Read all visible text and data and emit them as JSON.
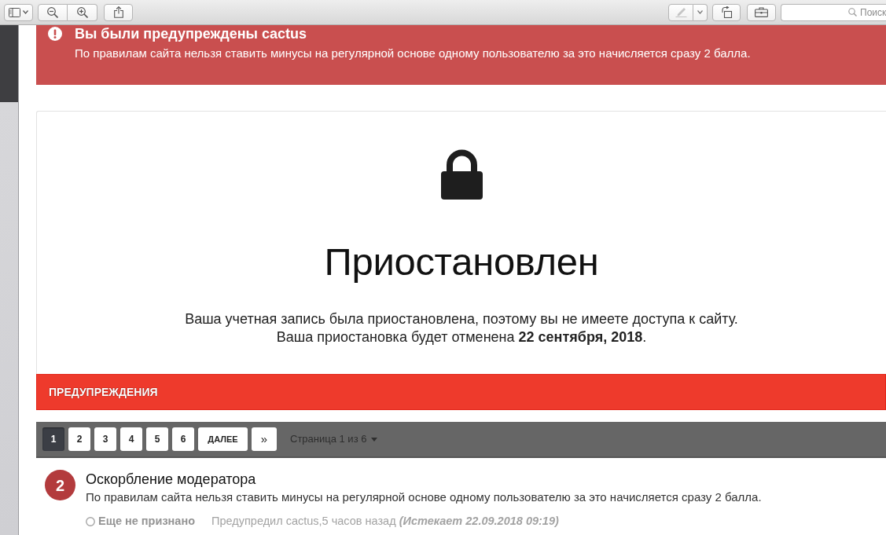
{
  "toolbar": {
    "markup": {
      "disabled": true
    },
    "search": {
      "placeholder": "Поиск"
    }
  },
  "alert": {
    "title": "Вы были предупреждены cactus",
    "text": "По правилам сайта нельзя ставить минусы на регулярной основе одному пользователю за это начисляется сразу 2 балла."
  },
  "suspension": {
    "title": "Приостановлен",
    "lines": [
      "Ваша учетная запись была приостановлена, поэтому вы не имеете доступа к сайту.",
      "Ваша приостановка будет отменена **22 сентября, 2018**."
    ]
  },
  "warnings": {
    "heading": "ПРЕДУПРЕЖДЕНИЯ",
    "pagination": {
      "pages": [
        {
          "label": "1",
          "selected": true
        },
        {
          "label": "2",
          "selected": false
        },
        {
          "label": "3",
          "selected": false
        },
        {
          "label": "4",
          "selected": false
        },
        {
          "label": "5",
          "selected": false
        },
        {
          "label": "6",
          "selected": false
        }
      ],
      "next": "ДАЛЕЕ",
      "last": "»",
      "page_info": "Страница 1 из 6"
    },
    "items": [
      {
        "points": "2",
        "title": "Оскорбление модератора",
        "text": "По правилам сайта нельзя ставить минусы на регулярной основе одному пользователю за это начисляется сразу 2 балла.",
        "status": "Еще не признано",
        "acknowledged": false,
        "issued": "Предупредил cactus,5 часов назад",
        "expires": "(Истекает 22.09.2018 09:19)"
      }
    ]
  }
}
